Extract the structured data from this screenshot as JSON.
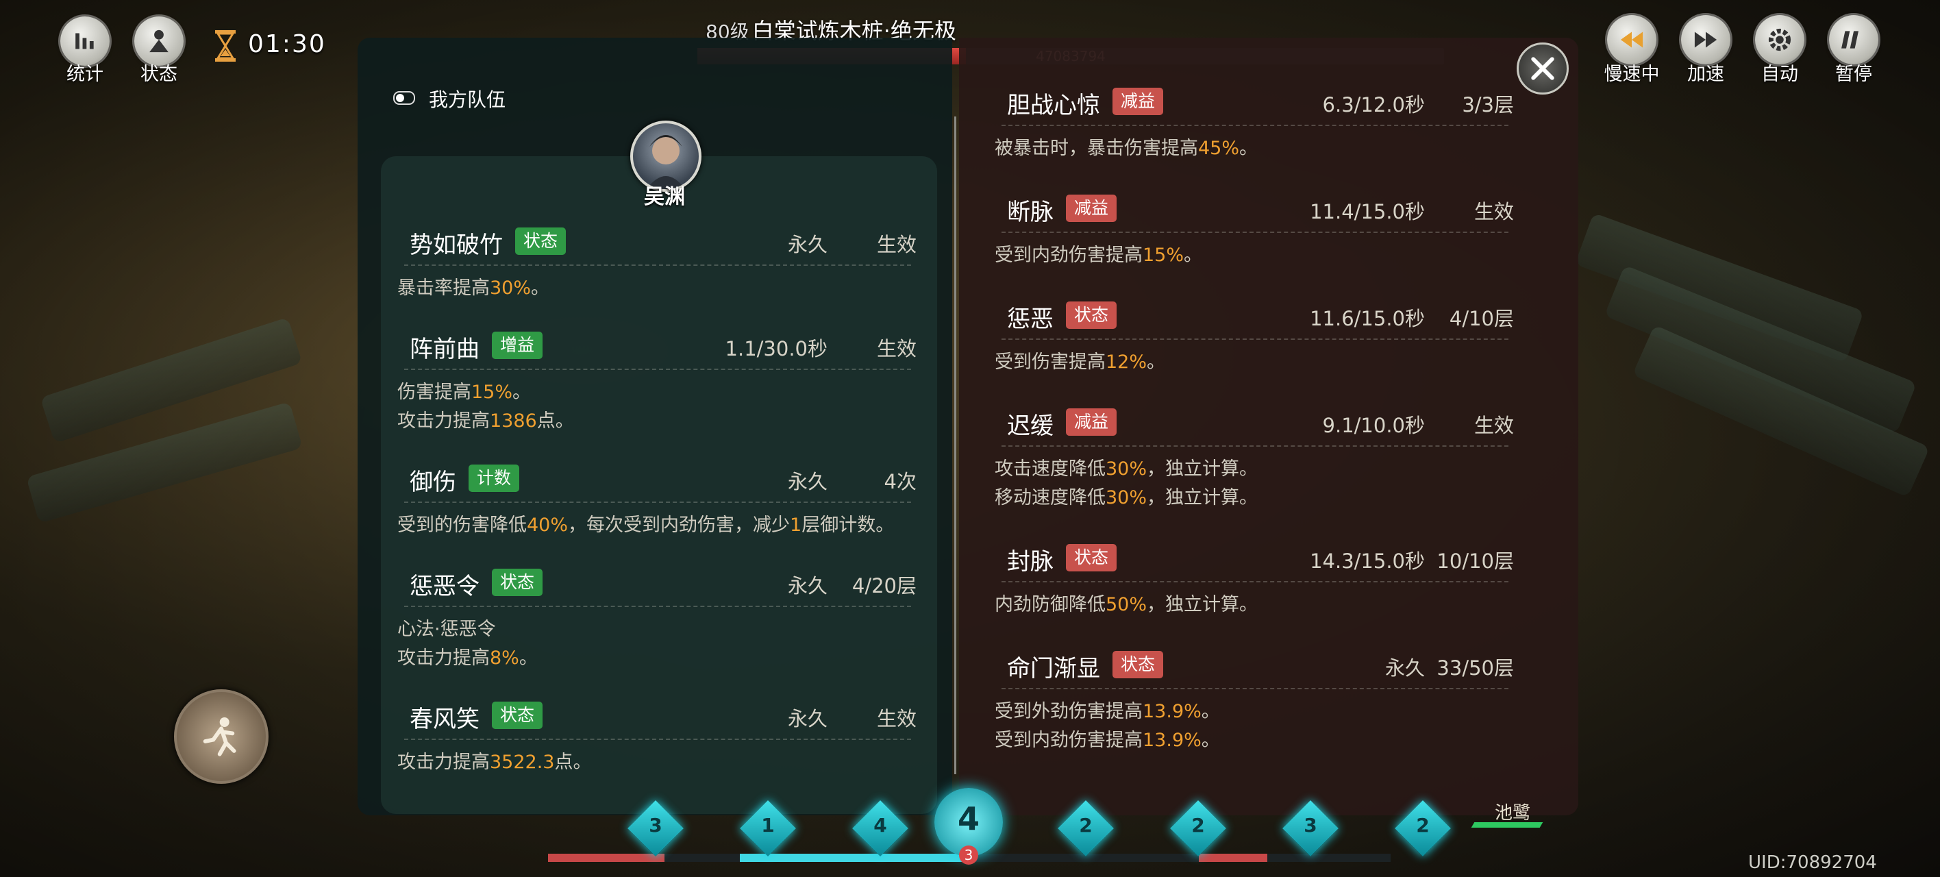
{
  "hud": {
    "stats_label": "统计",
    "status_label": "状态",
    "timer": "01:30"
  },
  "boss": {
    "level": "80级",
    "name": "白棠试炼木桩·绝无极",
    "hp_text": "47083794",
    "hp_fraction": 0.36
  },
  "controls": {
    "slow_label": "慢速中",
    "fast_label": "加速",
    "auto_label": "自动",
    "pause_label": "暂停"
  },
  "team": {
    "header": "我方队伍",
    "hero_name": "吴渊",
    "buffs": [
      {
        "name": "势如破竹",
        "tag": "状态",
        "duration": "永久",
        "effect": "生效",
        "desc": [
          [
            "暴击率提高",
            "30%",
            "。"
          ]
        ]
      },
      {
        "name": "阵前曲",
        "tag": "增益",
        "duration": "1.1/30.0秒",
        "effect": "生效",
        "desc": [
          [
            "伤害提高",
            "15%",
            "。"
          ],
          [
            "攻击力提高",
            "1386",
            "点。"
          ]
        ]
      },
      {
        "name": "御伤",
        "tag": "计数",
        "duration": "永久",
        "effect": "4次",
        "desc": [
          [
            "受到的伤害降低",
            "40%",
            "，每次受到内劲伤害，减少",
            "1",
            "层御计数。"
          ]
        ]
      },
      {
        "name": "惩恶令",
        "tag": "状态",
        "duration": "永久",
        "effect": "4/20层",
        "desc": [
          [
            "心法·惩恶令"
          ],
          [
            "攻击力提高",
            "8%",
            "。"
          ]
        ]
      },
      {
        "name": "春风笑",
        "tag": "状态",
        "duration": "永久",
        "effect": "生效",
        "desc": [
          [
            "攻击力提高",
            "3522.3",
            "点。"
          ]
        ]
      }
    ]
  },
  "enemy": {
    "debuffs": [
      {
        "name": "胆战心惊",
        "tag": "减益",
        "duration": "6.3/12.0秒",
        "effect": "3/3层",
        "desc": [
          [
            "被暴击时，暴击伤害提高",
            "45%",
            "。"
          ]
        ]
      },
      {
        "name": "断脉",
        "tag": "减益",
        "duration": "11.4/15.0秒",
        "effect": "生效",
        "desc": [
          [
            "受到内劲伤害提高",
            "15%",
            "。"
          ]
        ]
      },
      {
        "name": "惩恶",
        "tag": "状态",
        "duration": "11.6/15.0秒",
        "effect": "4/10层",
        "desc": [
          [
            "受到伤害提高",
            "12%",
            "。"
          ]
        ]
      },
      {
        "name": "迟缓",
        "tag": "减益",
        "duration": "9.1/10.0秒",
        "effect": "生效",
        "desc": [
          [
            "攻击速度降低",
            "30%",
            "，独立计算。"
          ],
          [
            "移动速度降低",
            "30%",
            "，独立计算。"
          ]
        ]
      },
      {
        "name": "封脉",
        "tag": "状态",
        "duration": "14.3/15.0秒",
        "effect": "10/10层",
        "desc": [
          [
            "内劲防御降低",
            "50%",
            "，独立计算。"
          ]
        ]
      },
      {
        "name": "命门渐显",
        "tag": "状态",
        "duration": "永久",
        "effect": "33/50层",
        "desc": [
          [
            "受到外劲伤害提高",
            "13.9%",
            "。"
          ],
          [
            "受到内劲伤害提高",
            "13.9%",
            "。"
          ]
        ]
      }
    ]
  },
  "bottom": {
    "slots": [
      "3",
      "1",
      "4",
      "2",
      "2",
      "3",
      "2"
    ],
    "center_value": "4",
    "center_sub": "3",
    "pool_label": "池鹭",
    "uid": "UID:70892704"
  },
  "colors": {
    "tag_green": "#2f9a45",
    "tag_red": "#c8524c",
    "highlight": "#f0a030"
  }
}
